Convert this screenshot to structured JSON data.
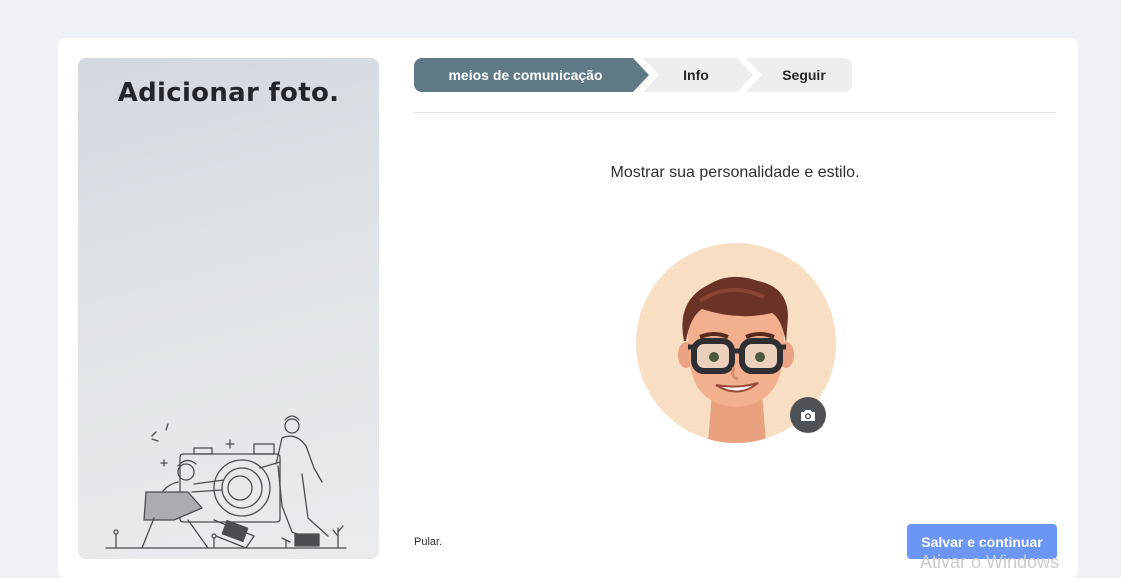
{
  "side_panel": {
    "title": "Adicionar foto."
  },
  "steps": [
    {
      "label": "meios de comunicação",
      "active": true
    },
    {
      "label": "Info",
      "active": false
    },
    {
      "label": "Seguir",
      "active": false
    }
  ],
  "main": {
    "subtitle": "Mostrar sua personalidade e estilo.",
    "avatar_icon": "memoji-avatar",
    "camera_icon": "camera-icon"
  },
  "footer": {
    "skip_label": "Pular.",
    "save_label": "Salvar e continuar"
  },
  "watermark": "Ativar o Windows",
  "colors": {
    "page_bg": "#eef1f5",
    "step_active": "#5f7986",
    "step_inactive": "#eceef0",
    "primary_button": "#6b96f6",
    "avatar_bg": "#f8dfc3"
  }
}
